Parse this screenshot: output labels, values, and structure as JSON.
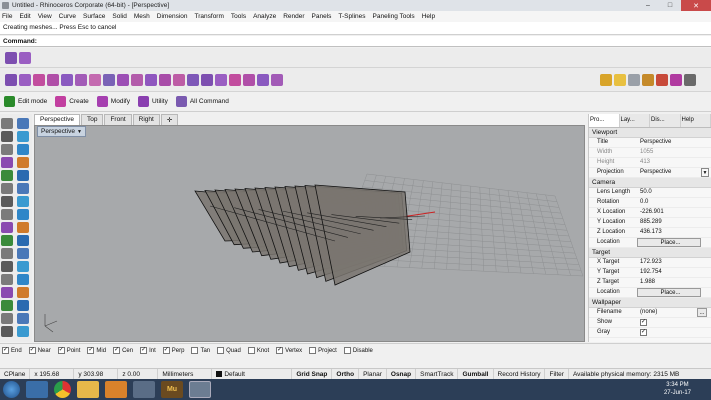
{
  "window": {
    "title": "Untitled - Rhinoceros Corporate (64-bit) - [Perspective]"
  },
  "menu": [
    "File",
    "Edit",
    "View",
    "Curve",
    "Surface",
    "Solid",
    "Mesh",
    "Dimension",
    "Transform",
    "Tools",
    "Analyze",
    "Render",
    "Panels",
    "T-Splines",
    "Paneling Tools",
    "Help"
  ],
  "command": {
    "history": "Creating meshes... Press Esc to cancel",
    "prompt": "Command:"
  },
  "cmdtabs": [
    {
      "label": "Edit mode",
      "icon": "power-icon",
      "color": "#2a8a2a"
    },
    {
      "label": "Create",
      "icon": "create-icon",
      "color": "#c23fa0"
    },
    {
      "label": "Modify",
      "icon": "modify-icon",
      "color": "#a63fb0"
    },
    {
      "label": "Utility",
      "icon": "utility-icon",
      "color": "#8a3fb0"
    },
    {
      "label": "All Command",
      "icon": "all-command-icon",
      "color": "#7a5ab0"
    }
  ],
  "viewport_tabs": [
    "Perspective",
    "Top",
    "Front",
    "Right"
  ],
  "viewport": {
    "label": "Perspective"
  },
  "panel": {
    "tabs": [
      "Pro...",
      "Lay...",
      "Dis...",
      "Help"
    ],
    "sections": {
      "viewport": "Viewport",
      "camera": "Camera",
      "target": "Target",
      "wallpaper": "Wallpaper"
    },
    "viewport_props": {
      "title_k": "Title",
      "title_v": "Perspective",
      "width_k": "Width",
      "width_v": "1055",
      "height_k": "Height",
      "height_v": "413",
      "projection_k": "Projection",
      "projection_v": "Perspective"
    },
    "camera_props": {
      "lens_k": "Lens Length",
      "lens_v": "50.0",
      "rot_k": "Rotation",
      "rot_v": "0.0",
      "x_k": "X Location",
      "x_v": "-226.901",
      "y_k": "Y Location",
      "y_v": "885.289",
      "z_k": "Z Location",
      "z_v": "436.173",
      "loc_k": "Location",
      "place": "Place..."
    },
    "target_props": {
      "x_k": "X Target",
      "x_v": "172.923",
      "y_k": "Y Target",
      "y_v": "192.754",
      "z_k": "Z Target",
      "z_v": "1.988",
      "loc_k": "Location",
      "place": "Place..."
    },
    "wallpaper_props": {
      "file_k": "Filename",
      "file_v": "(none)",
      "show_k": "Show",
      "gray_k": "Gray",
      "browse": "..."
    }
  },
  "osnap": [
    {
      "label": "End",
      "checked": true
    },
    {
      "label": "Near",
      "checked": true
    },
    {
      "label": "Point",
      "checked": true
    },
    {
      "label": "Mid",
      "checked": true
    },
    {
      "label": "Cen",
      "checked": true
    },
    {
      "label": "Int",
      "checked": true
    },
    {
      "label": "Perp",
      "checked": true
    },
    {
      "label": "Tan",
      "checked": false
    },
    {
      "label": "Quad",
      "checked": false
    },
    {
      "label": "Knot",
      "checked": false
    },
    {
      "label": "Vertex",
      "checked": true
    },
    {
      "label": "Project",
      "checked": false
    },
    {
      "label": "Disable",
      "checked": false
    }
  ],
  "status": {
    "cplane": "CPlane",
    "x": "x 195.68",
    "y": "y 303.98",
    "z": "z 0.00",
    "units": "Millimeters",
    "layer": "Default",
    "toggles": [
      "Grid Snap",
      "Ortho",
      "Planar",
      "Osnap",
      "SmartTrack",
      "Gumball",
      "Record History",
      "Filter"
    ],
    "memory": "Available physical memory: 2315 MB"
  },
  "clock": {
    "time": "3:34 PM",
    "date": "27-Jun-17"
  },
  "taskbar": {
    "mu_label": "Mu"
  }
}
